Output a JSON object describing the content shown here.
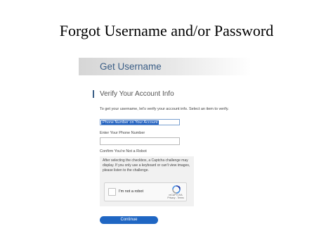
{
  "slide": {
    "title": "Forgot Username and/or Password"
  },
  "page": {
    "banner_title": "Get Username",
    "section_title": "Verify Your Account Info",
    "intro_text": "To get your username, let's verify your account info. Select an item to verify."
  },
  "verify_select": {
    "selected": "Phone Number on Your Account"
  },
  "phone": {
    "label": "Enter Your Phone Number",
    "value": ""
  },
  "robot": {
    "label": "Confirm You're Not a Robot",
    "help_text": "After selecting the checkbox, a Captcha challenge may display. If you only use a keyboard or can't view images, please listen to the challenge.",
    "checkbox_label": "I'm not a robot",
    "brand": "reCAPTCHA",
    "links": "Privacy - Terms"
  },
  "continue_button": {
    "label": "Continue"
  },
  "colors": {
    "accent": "#1f66c3",
    "banner_text": "#3b5e86",
    "panel": "#f1f1f1"
  },
  "icons": {
    "recaptcha": "recaptcha-logo-icon"
  }
}
